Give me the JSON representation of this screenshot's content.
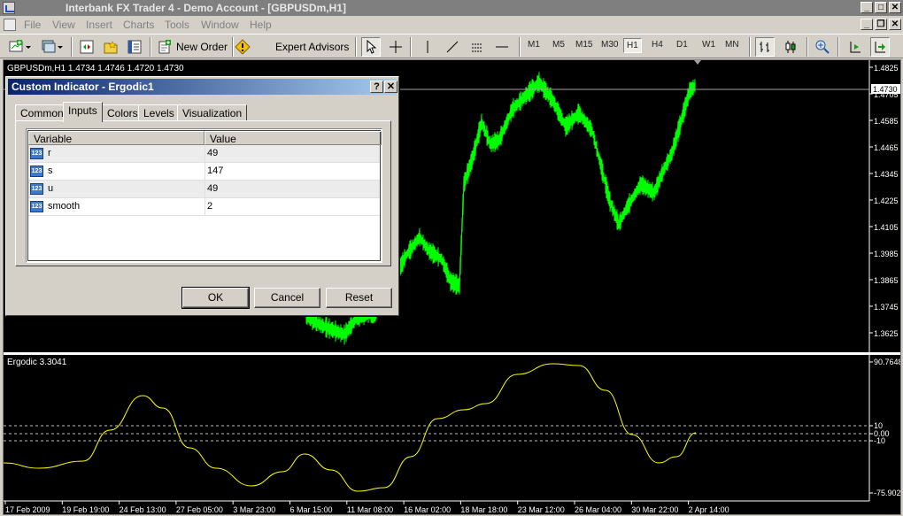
{
  "window": {
    "title": "Interbank FX Trader 4 - Demo Account - [GBPUSDm,H1]",
    "min_glyph": "_",
    "max_glyph": "□",
    "close_glyph": "✕",
    "restore_glyph": "❐"
  },
  "menu": [
    "File",
    "View",
    "Insert",
    "Charts",
    "Tools",
    "Window",
    "Help"
  ],
  "toolbar": {
    "new_order": "New Order",
    "expert_advisors": "Expert Advisors",
    "timeframes": [
      "M1",
      "M5",
      "M15",
      "M30",
      "H1",
      "H4",
      "D1",
      "W1",
      "MN"
    ],
    "active_timeframe": "H1"
  },
  "chart": {
    "info": "GBPUSDm,H1  1.4734 1.4746 1.4720 1.4730",
    "current_price": "1.4730",
    "price_ticks": [
      "1.4825",
      "1.4705",
      "1.4585",
      "1.4465",
      "1.4345",
      "1.4225",
      "1.4105",
      "1.3985",
      "1.3865",
      "1.3745",
      "1.3625"
    ],
    "sub_info": "Ergodic 3.3041",
    "sub_ticks": [
      "90.7648",
      "10",
      "0.00",
      "-10",
      "-75.9021"
    ],
    "date_ticks": [
      "17 Feb 2009",
      "19 Feb 19:00",
      "24 Feb 13:00",
      "27 Feb 05:00",
      "3 Mar 23:00",
      "6 Mar 15:00",
      "11 Mar 08:00",
      "16 Mar 02:00",
      "18 Mar 18:00",
      "23 Mar 12:00",
      "26 Mar 04:00",
      "30 Mar 22:00",
      "2 Apr 14:00"
    ],
    "colors": {
      "price": "#00ff00",
      "oscillator": "#ffff00",
      "background": "#000000"
    }
  },
  "dialog": {
    "title": "Custom Indicator - Ergodic1",
    "help_glyph": "?",
    "close_glyph": "✕",
    "tabs": [
      "Common",
      "Inputs",
      "Colors",
      "Levels",
      "Visualization"
    ],
    "active_tab": "Inputs",
    "columns": [
      "Variable",
      "Value"
    ],
    "param_icon_text": "123",
    "rows": [
      {
        "variable": "r",
        "value": "49"
      },
      {
        "variable": "s",
        "value": "147"
      },
      {
        "variable": "u",
        "value": "49"
      },
      {
        "variable": "smooth",
        "value": "2"
      }
    ],
    "ok": "OK",
    "cancel": "Cancel",
    "reset": "Reset"
  }
}
